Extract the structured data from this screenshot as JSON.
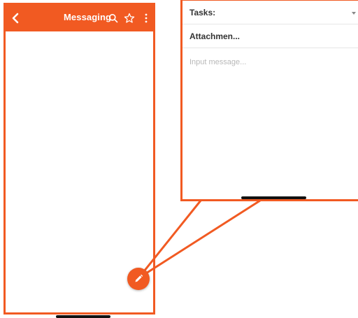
{
  "app_bar": {
    "title": "Messaging",
    "icons": [
      "back-chevron-icon",
      "search-icon",
      "star-outline-icon",
      "more-vertical-icon"
    ],
    "color": "#f15a22"
  },
  "compose": {
    "tasks_label": "Tasks:",
    "attachments_label": "Attachmen...",
    "message_placeholder": "Input message..."
  },
  "fab": {
    "icon": "pencil-icon"
  },
  "accent": "#f15a22"
}
